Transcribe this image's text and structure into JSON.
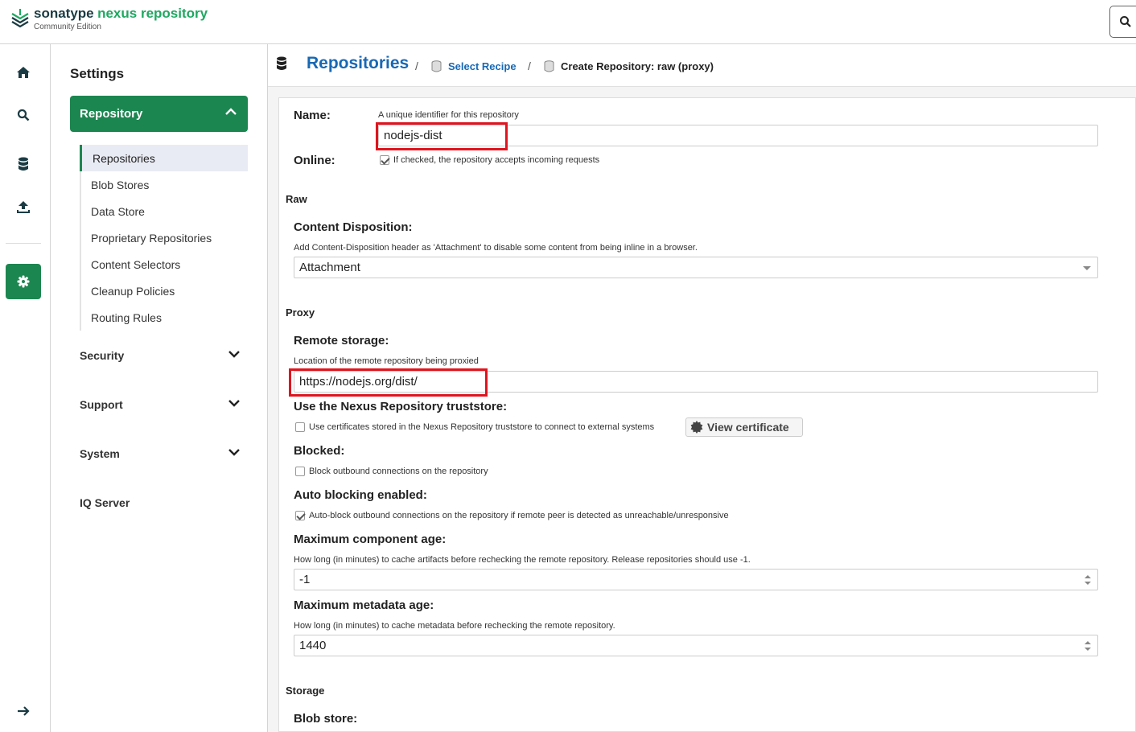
{
  "header": {
    "logo_sonatype": "sonatype",
    "logo_product": "nexus repository",
    "logo_edition": "Community Edition"
  },
  "rail": {
    "items": [
      "home-icon",
      "search-icon",
      "database-icon",
      "upload-icon",
      "gear-icon",
      "arrow-right-icon"
    ]
  },
  "sidebar": {
    "title": "Settings",
    "active_group": "Repository",
    "sub_items": [
      {
        "label": "Repositories",
        "active": true
      },
      {
        "label": "Blob Stores",
        "active": false
      },
      {
        "label": "Data Store",
        "active": false
      },
      {
        "label": "Proprietary Repositories",
        "active": false
      },
      {
        "label": "Content Selectors",
        "active": false
      },
      {
        "label": "Cleanup Policies",
        "active": false
      },
      {
        "label": "Routing Rules",
        "active": false
      }
    ],
    "groups": [
      "Security",
      "Support",
      "System",
      "IQ Server"
    ]
  },
  "breadcrumb": {
    "title": "Repositories",
    "sep": "/",
    "link": "Select Recipe",
    "current": "Create Repository: raw (proxy)"
  },
  "form": {
    "name_label": "Name:",
    "name_help": "A unique identifier for this repository",
    "name_value": "nodejs-dist",
    "online_label": "Online:",
    "online_help": "If checked, the repository accepts incoming requests",
    "section_raw": "Raw",
    "content_disposition_label": "Content Disposition:",
    "content_disposition_help": "Add Content-Disposition header as 'Attachment' to disable some content from being inline in a browser.",
    "content_disposition_value": "Attachment",
    "section_proxy": "Proxy",
    "remote_storage_label": "Remote storage:",
    "remote_storage_help": "Location of the remote repository being proxied",
    "remote_storage_value": "https://nodejs.org/dist/",
    "truststore_label": "Use the Nexus Repository truststore:",
    "truststore_help": "Use certificates stored in the Nexus Repository truststore to connect to external systems",
    "view_certificate": "View certificate",
    "blocked_label": "Blocked:",
    "blocked_help": "Block outbound connections on the repository",
    "auto_blocking_label": "Auto blocking enabled:",
    "auto_blocking_help": "Auto-block outbound connections on the repository if remote peer is detected as unreachable/unresponsive",
    "max_component_age_label": "Maximum component age:",
    "max_component_age_help": "How long (in minutes) to cache artifacts before rechecking the remote repository. Release repositories should use -1.",
    "max_component_age_value": "-1",
    "max_metadata_age_label": "Maximum metadata age:",
    "max_metadata_age_help": "How long (in minutes) to cache metadata before rechecking the remote repository.",
    "max_metadata_age_value": "1440",
    "section_storage": "Storage",
    "blob_store_label": "Blob store:"
  },
  "colors": {
    "brand_green": "#1c8650",
    "link_blue": "#1868b4",
    "highlight_red": "#e0141e"
  }
}
